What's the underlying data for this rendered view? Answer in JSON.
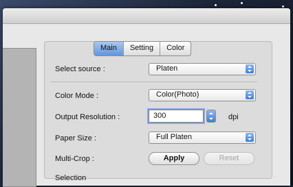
{
  "tabs": [
    {
      "label": "Main",
      "active": true
    },
    {
      "label": "Setting",
      "active": false
    },
    {
      "label": "Color",
      "active": false
    }
  ],
  "select_source": {
    "label": "Select source :",
    "value": "Platen"
  },
  "color_mode": {
    "label": "Color Mode :",
    "value": "Color(Photo)"
  },
  "output_resolution": {
    "label": "Output Resolution :",
    "value": "300",
    "unit": "dpi"
  },
  "paper_size": {
    "label": "Paper Size :",
    "value": "Full Platen"
  },
  "multi_crop": {
    "label": "Multi-Crop :",
    "apply_label": "Apply",
    "reset_label": "Reset"
  },
  "selection": {
    "label": "Selection"
  },
  "colors": {
    "accent": "#5f96de",
    "panel": "#dcdcdc",
    "window": "#e8e8e8"
  }
}
